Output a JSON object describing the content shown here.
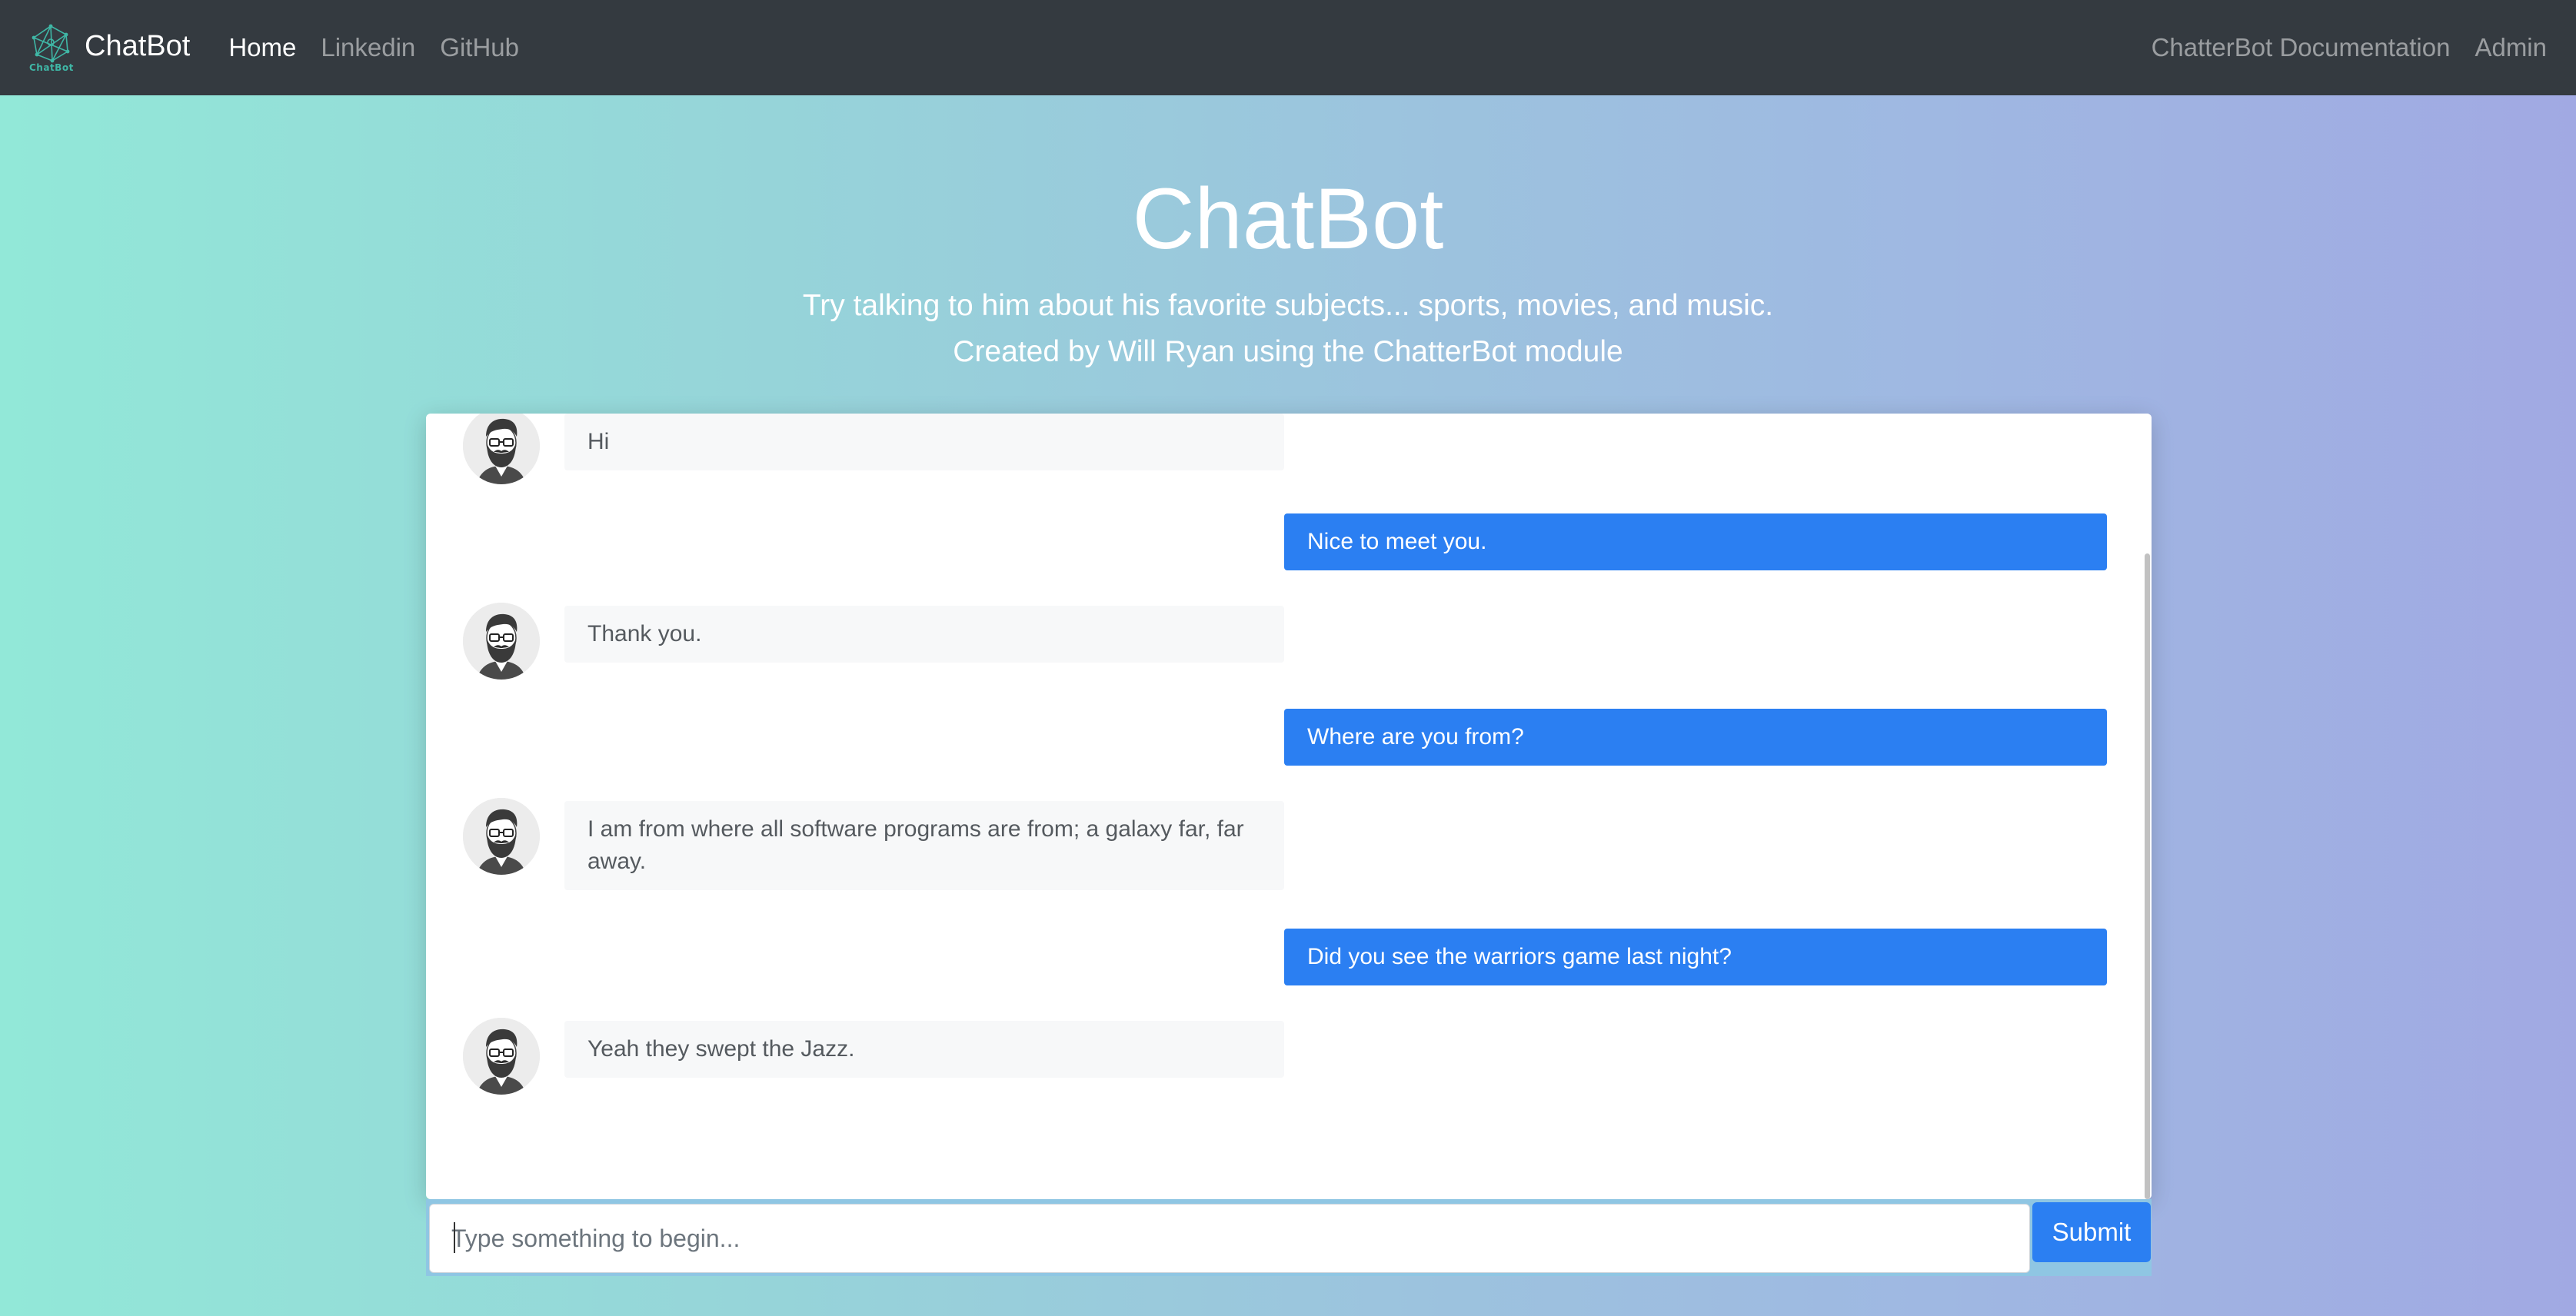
{
  "navbar": {
    "logo_text": "ChatBot",
    "brand": "ChatBot",
    "links": [
      {
        "label": "Home",
        "active": true
      },
      {
        "label": "Linkedin",
        "active": false
      },
      {
        "label": "GitHub",
        "active": false
      }
    ],
    "right_links": [
      {
        "label": "ChatterBot Documentation"
      },
      {
        "label": "Admin"
      }
    ]
  },
  "hero": {
    "title": "ChatBot",
    "subtitle_1": "Try talking to him about his favorite subjects... sports, movies, and music.",
    "subtitle_2": "Created by Will Ryan using the ChatterBot module"
  },
  "chat": {
    "messages": [
      {
        "sender": "bot",
        "text": "Hi"
      },
      {
        "sender": "user",
        "text": "Nice to meet you."
      },
      {
        "sender": "bot",
        "text": "Thank you."
      },
      {
        "sender": "user",
        "text": "Where are you from?"
      },
      {
        "sender": "bot",
        "text": "I am from where all software programs are from; a galaxy far, far away."
      },
      {
        "sender": "user",
        "text": "Did you see the warriors game last night?"
      },
      {
        "sender": "bot",
        "text": "Yeah they swept the Jazz."
      }
    ]
  },
  "input": {
    "placeholder": "Type something to begin...",
    "value": "",
    "submit_label": "Submit"
  },
  "colors": {
    "navbar_bg": "#343a40",
    "user_bubble": "#2b7ff2",
    "bot_bubble": "#f7f8f9",
    "submit_button": "#2b7ff2"
  },
  "icons": {
    "logo": "network-globe-icon",
    "avatar": "bearded-man-avatar-icon"
  }
}
